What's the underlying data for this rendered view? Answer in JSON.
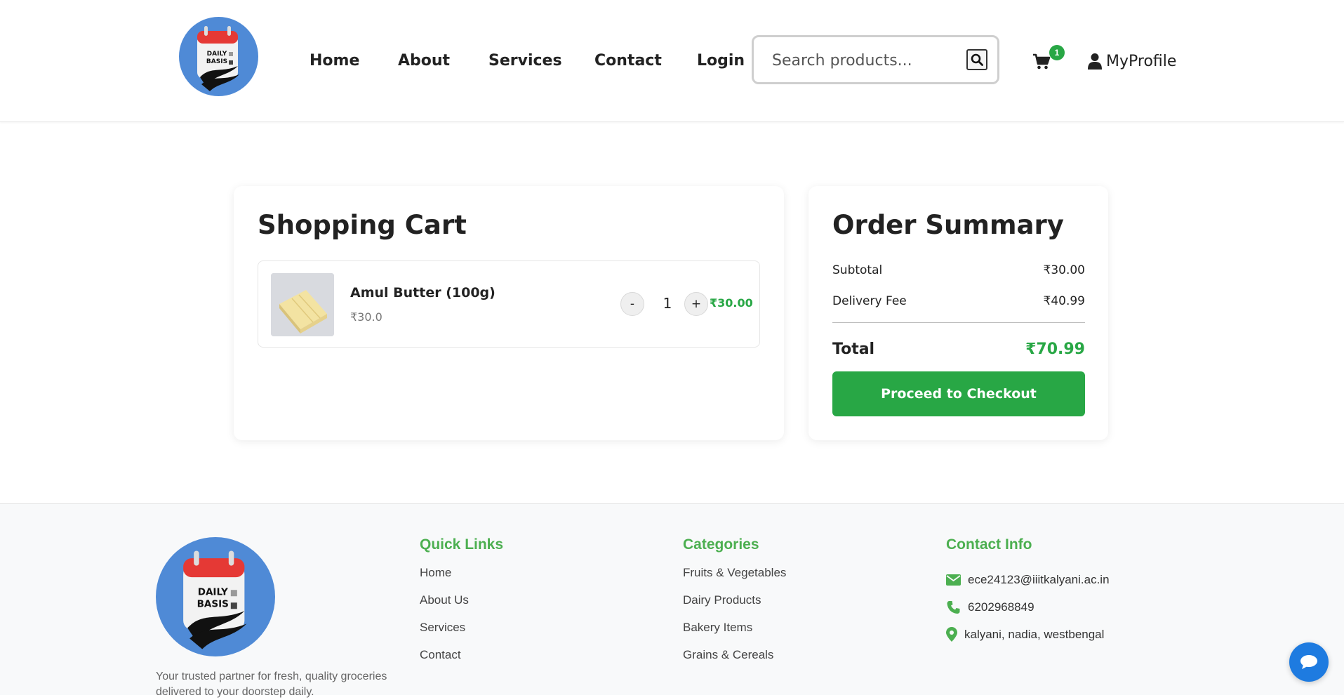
{
  "brand": {
    "logo_text_line1": "DAILY",
    "logo_text_line2": "BASIS",
    "primary_color": "#4f8ad6",
    "accent_color": "#28a745"
  },
  "nav": {
    "items": [
      {
        "label": "Home"
      },
      {
        "label": "About"
      },
      {
        "label": "Services"
      },
      {
        "label": "Contact"
      },
      {
        "label": "Login"
      }
    ]
  },
  "search": {
    "placeholder": "Search products...",
    "icon": "search-icon"
  },
  "cart": {
    "count": "1",
    "icon": "cart-icon"
  },
  "profile": {
    "label": "MyProfile",
    "icon": "user-icon"
  },
  "cart_panel": {
    "title": "Shopping Cart",
    "items": [
      {
        "name": "Amul Butter (100g)",
        "unit_price": "₹30.0",
        "quantity": "1",
        "line_total": "₹30.00",
        "minus": "-",
        "plus": "+"
      }
    ]
  },
  "summary": {
    "title": "Order Summary",
    "subtotal_label": "Subtotal",
    "subtotal_value": "₹30.00",
    "delivery_label": "Delivery Fee",
    "delivery_value": "₹40.99",
    "total_label": "Total",
    "total_value": "₹70.99",
    "checkout_label": "Proceed to Checkout"
  },
  "footer": {
    "tagline": "Your trusted partner for fresh, quality groceries delivered to your doorstep daily.",
    "quick_links": {
      "title": "Quick Links",
      "items": [
        "Home",
        "About Us",
        "Services",
        "Contact"
      ]
    },
    "categories": {
      "title": "Categories",
      "items": [
        "Fruits & Vegetables",
        "Dairy Products",
        "Bakery Items",
        "Grains & Cereals"
      ]
    },
    "contact": {
      "title": "Contact Info",
      "email": "ece24123@iiitkalyani.ac.in",
      "phone": "6202968849",
      "address": "kalyani, nadia, westbengal"
    }
  },
  "chat": {
    "icon": "chat-icon"
  }
}
